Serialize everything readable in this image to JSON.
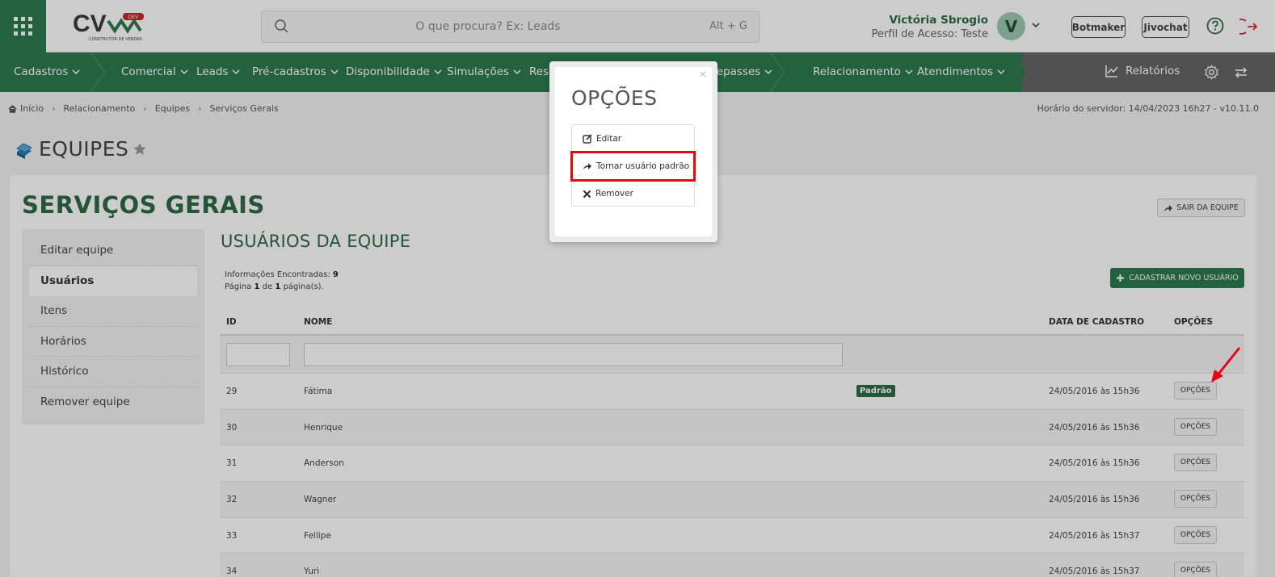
{
  "header": {
    "logo_text": "CV",
    "logo_badge": "DEV",
    "logo_sub": "CONSTRUTOR DE VENDAS",
    "search_placeholder": "O que procura? Ex: Leads",
    "search_shortcut": "Alt + G",
    "user_name": "Victória Sbrogio",
    "user_profile": "Perfil de Acesso: Teste",
    "avatar_letter": "V",
    "botmaker_label": "Botmaker",
    "jivochat_label": "Jivochat"
  },
  "nav": {
    "items": [
      "Cadastros",
      "Comercial",
      "Leads",
      "Pré-cadastros",
      "Disponibilidade",
      "Simulações",
      "Rese",
      "Repasses",
      "Relacionamento",
      "Atendimentos"
    ],
    "reports_label": "Relatórios"
  },
  "breadcrumb": [
    "Início",
    "Relacionamento",
    "Equipes",
    "Serviços Gerais"
  ],
  "server_time": "Horário do servidor: 14/04/2023 16h27 - v10.11.0",
  "page": {
    "title": "EQUIPES",
    "team_name": "SERVIÇOS GERAIS",
    "leave_team_label": "SAIR DA EQUIPE"
  },
  "sidemenu": [
    "Editar equipe",
    "Usuários",
    "Itens",
    "Horários",
    "Histórico",
    "Remover equipe"
  ],
  "users": {
    "section_title": "USUÁRIOS DA EQUIPE",
    "found_label": "Informações Encontradas:",
    "found_count": "9",
    "page_prefix": "Página",
    "page_current": "1",
    "page_of": "de",
    "page_total": "1",
    "page_suffix": "página(s).",
    "new_user_label": "CADASTRAR NOVO USUÁRIO",
    "columns": {
      "id": "ID",
      "name": "NOME",
      "date": "DATA DE CADASTRO",
      "options": "OPÇÕES"
    },
    "default_badge": "Padrão",
    "options_label": "OPÇÕES",
    "rows": [
      {
        "id": "29",
        "name": "Fátima",
        "date": "24/05/2016 às 15h36"
      },
      {
        "id": "30",
        "name": "Henrique",
        "date": "24/05/2016 às 15h36"
      },
      {
        "id": "31",
        "name": "Anderson",
        "date": "24/05/2016 às 15h36"
      },
      {
        "id": "32",
        "name": "Wagner",
        "date": "24/05/2016 às 15h36"
      },
      {
        "id": "33",
        "name": "Fellipe",
        "date": "24/05/2016 às 15h37"
      },
      {
        "id": "34",
        "name": "Yuri",
        "date": "24/05/2016 às 15h37"
      }
    ]
  },
  "modal": {
    "title": "OPÇÕES",
    "close": "×",
    "items": [
      "Editar",
      "Tornar usuário padrão",
      "Remover"
    ]
  },
  "colors": {
    "brand_green": "#2e7a4f",
    "highlight_red": "#e30613"
  }
}
